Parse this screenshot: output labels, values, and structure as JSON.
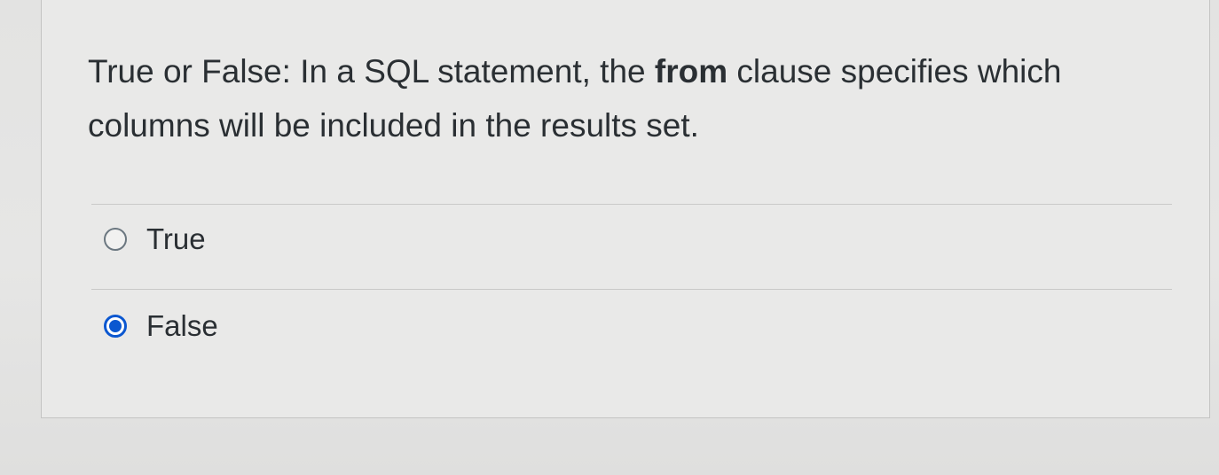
{
  "question": {
    "text_before_bold": "True or False: In a SQL statement, the ",
    "bold_keyword": "from",
    "text_line1_end": " clause specifies which",
    "text_line2": "columns will be included in the results set."
  },
  "answers": [
    {
      "label": "True",
      "selected": false
    },
    {
      "label": "False",
      "selected": true
    }
  ],
  "colors": {
    "selected_radio": "#0b57d0",
    "text": "#2a2f33",
    "background": "#e9e9e8"
  }
}
